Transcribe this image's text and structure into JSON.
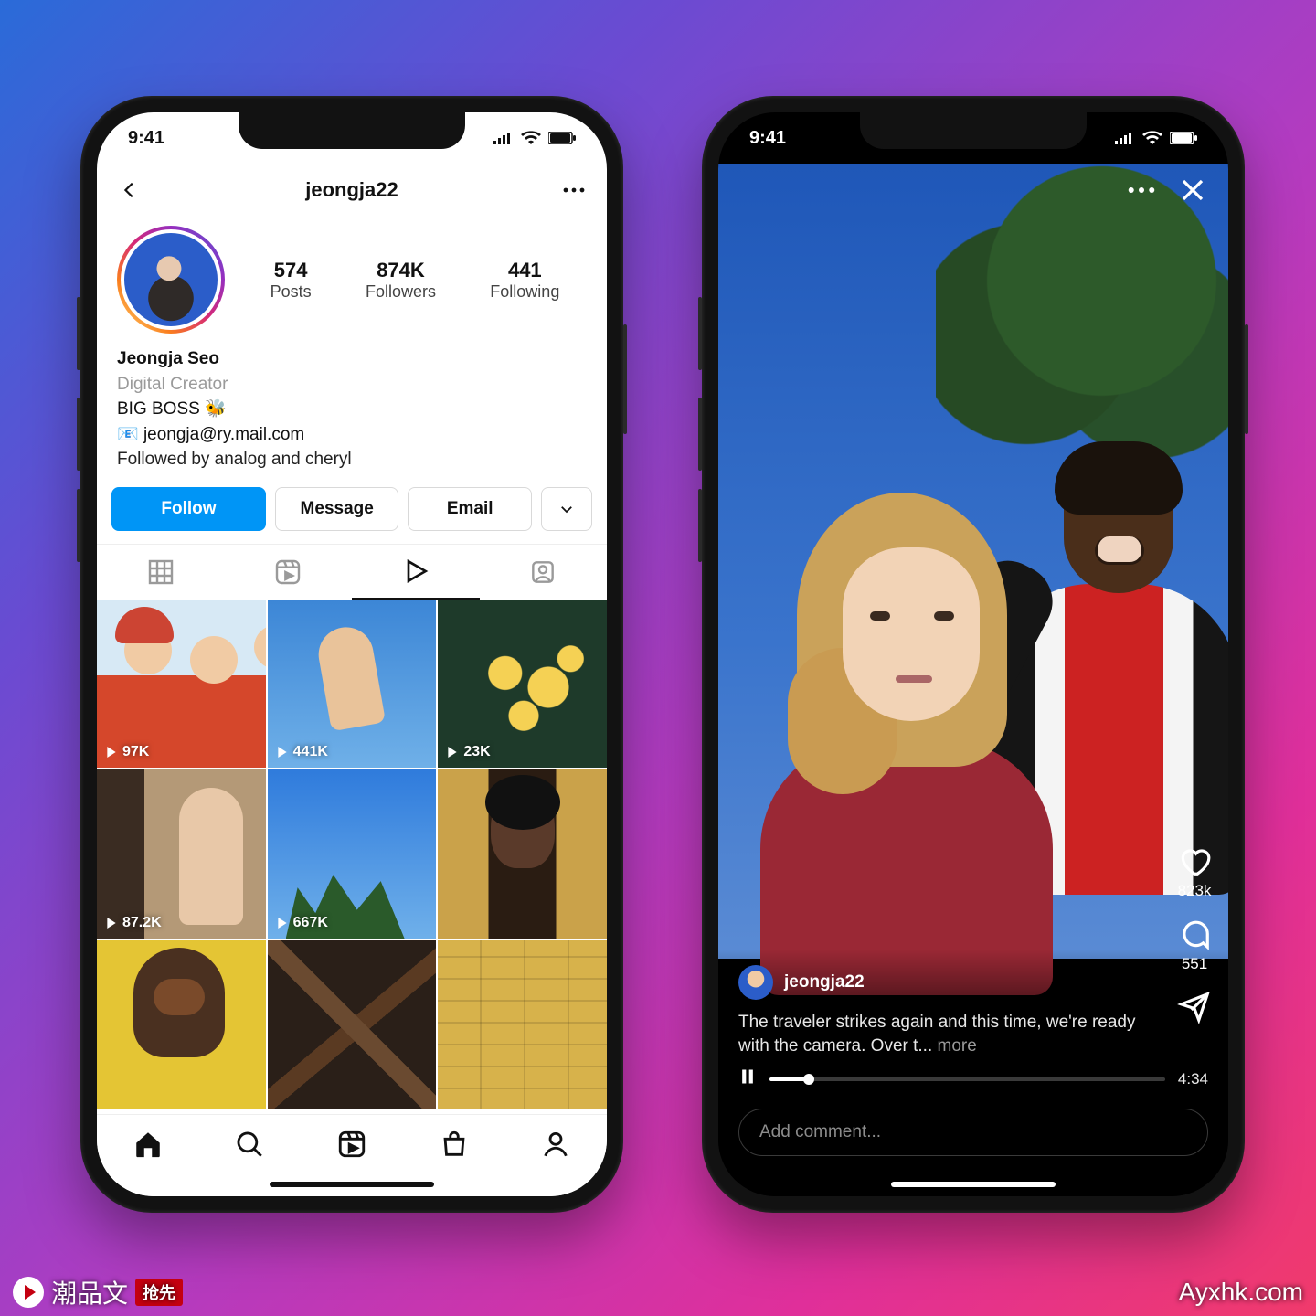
{
  "status": {
    "time": "9:41"
  },
  "left": {
    "username": "jeongja22",
    "stats": {
      "posts": {
        "num": "574",
        "label": "Posts"
      },
      "followers": {
        "num": "874K",
        "label": "Followers"
      },
      "following": {
        "num": "441",
        "label": "Following"
      }
    },
    "bio": {
      "name": "Jeongja Seo",
      "category": "Digital Creator",
      "line1": "BIG BOSS 🐝",
      "email": "jeongja@ry.mail.com",
      "followed": "Followed by analog and cheryl"
    },
    "cta": {
      "follow": "Follow",
      "message": "Message",
      "email": "Email"
    },
    "gridViews": [
      "97K",
      "441K",
      "23K",
      "87.2K",
      "667K"
    ]
  },
  "right": {
    "poster": "jeongja22",
    "caption": "The traveler strikes again and this time, we're ready with the camera. Over t...",
    "more": " more",
    "likes": "823k",
    "comments": "551",
    "duration": "4:34",
    "comment_placeholder": "Add comment..."
  },
  "watermark": {
    "left": "潮品文",
    "ribbon": "抢先",
    "right": "Ayxhk.com"
  }
}
